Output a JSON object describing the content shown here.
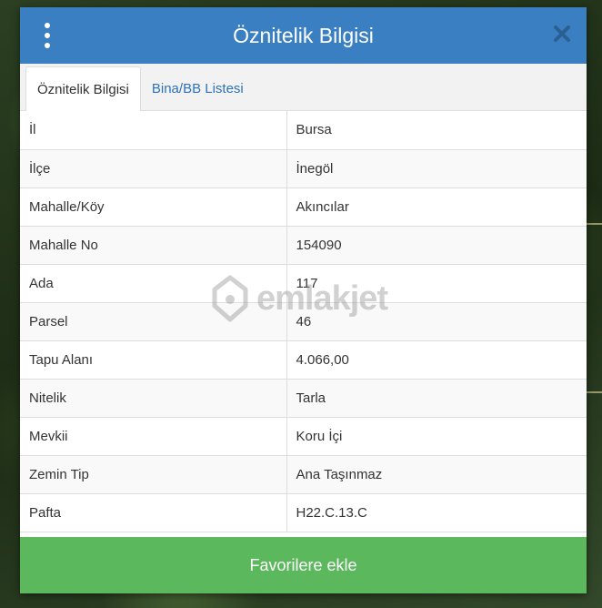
{
  "dialog": {
    "title": "Öznitelik Bilgisi",
    "tabs": [
      {
        "label": "Öznitelik Bilgisi",
        "active": true
      },
      {
        "label": "Bina/BB Listesi",
        "active": false
      }
    ],
    "rows": [
      {
        "key": "İl",
        "value": "Bursa"
      },
      {
        "key": "İlçe",
        "value": "İnegöl"
      },
      {
        "key": "Mahalle/Köy",
        "value": "Akıncılar"
      },
      {
        "key": "Mahalle No",
        "value": "154090"
      },
      {
        "key": "Ada",
        "value": "117"
      },
      {
        "key": "Parsel",
        "value": "46"
      },
      {
        "key": "Tapu Alanı",
        "value": "4.066,00"
      },
      {
        "key": "Nitelik",
        "value": "Tarla"
      },
      {
        "key": "Mevkii",
        "value": "Koru İçi"
      },
      {
        "key": "Zemin Tip",
        "value": "Ana Taşınmaz"
      },
      {
        "key": "Pafta",
        "value": "H22.C.13.C"
      }
    ],
    "footer_button": "Favorilere ekle",
    "watermark": "emlakjet"
  },
  "colors": {
    "header": "#3a7fc2",
    "footer": "#5cb85c",
    "tab_link": "#2f73b4"
  }
}
